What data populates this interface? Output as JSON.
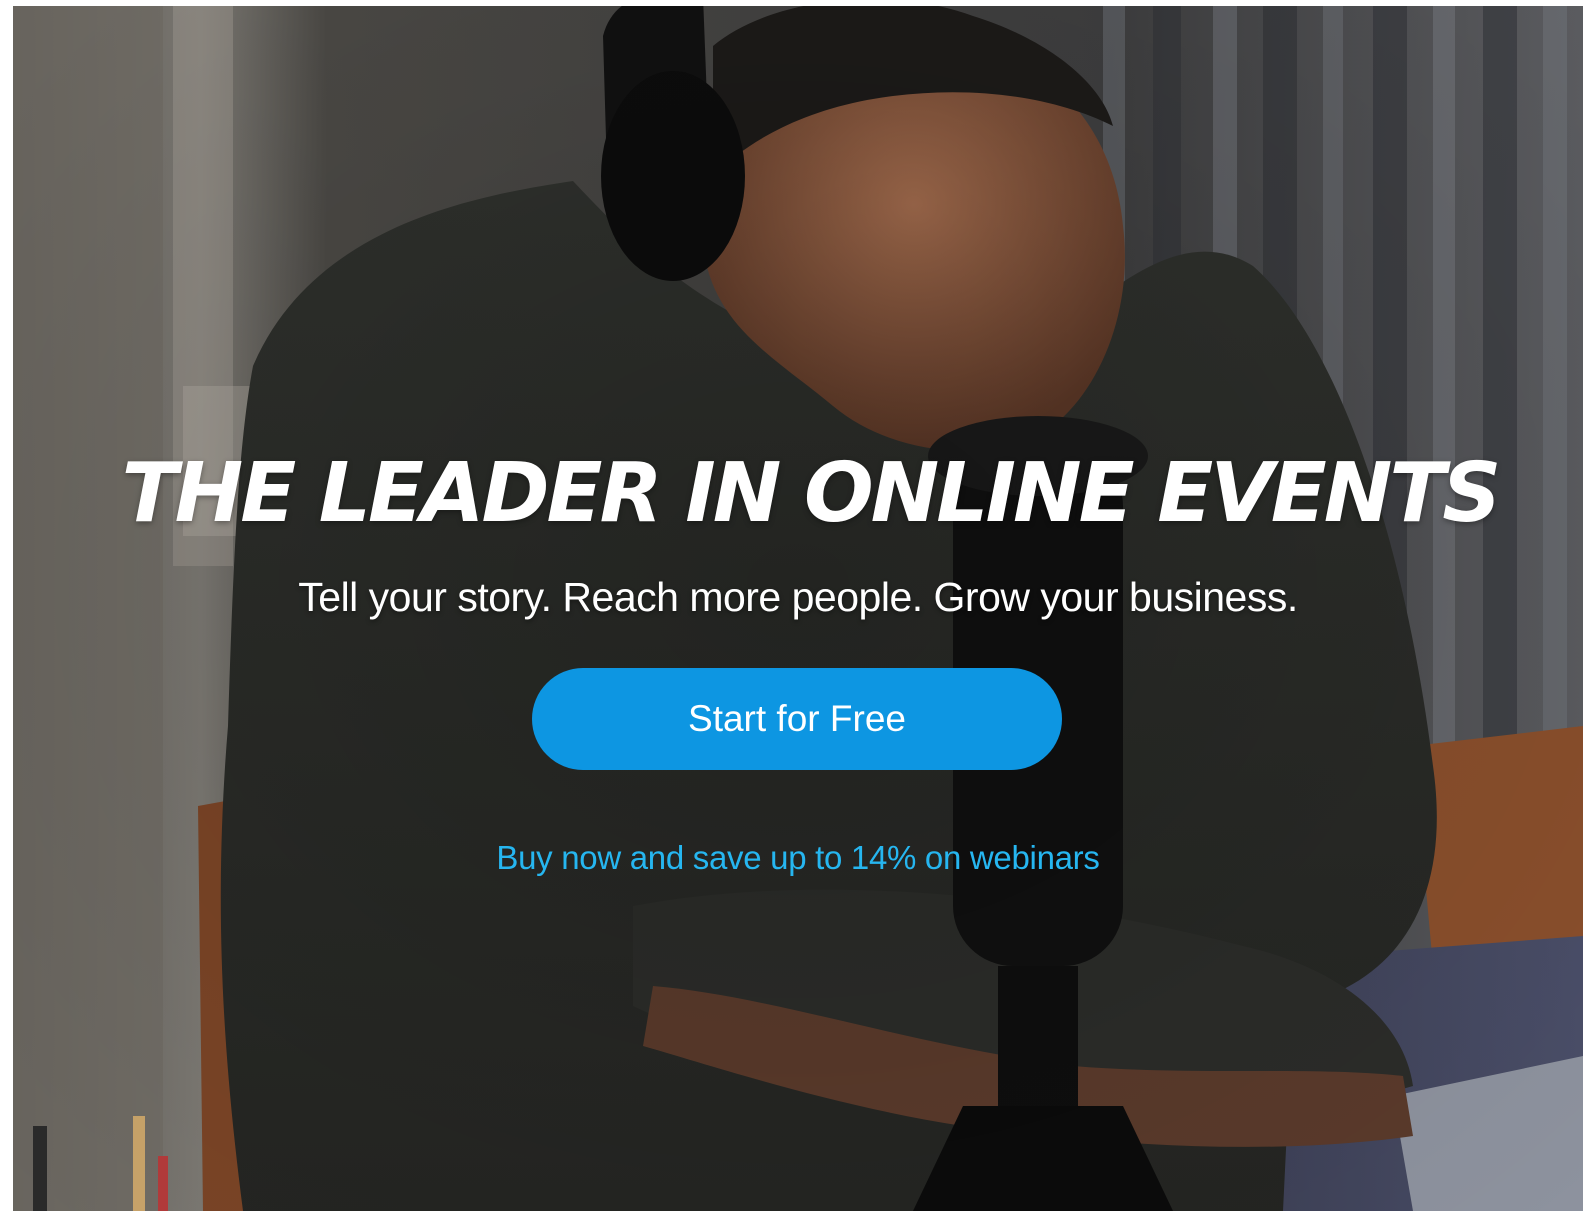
{
  "hero": {
    "image_alt": "Man wearing headphones speaking into a microphone at a desk with a laptop",
    "headline": "THE LEADER IN ONLINE EVENTS",
    "subheadline": "Tell your story. Reach more people. Grow your business.",
    "cta_label": "Start for Free",
    "promo_text": "Buy now and save up to 14% on webinars"
  },
  "colors": {
    "cta_background": "#0d96e2",
    "cta_text": "#ffffff",
    "promo_link": "#26b6f0",
    "headline": "#ffffff"
  }
}
